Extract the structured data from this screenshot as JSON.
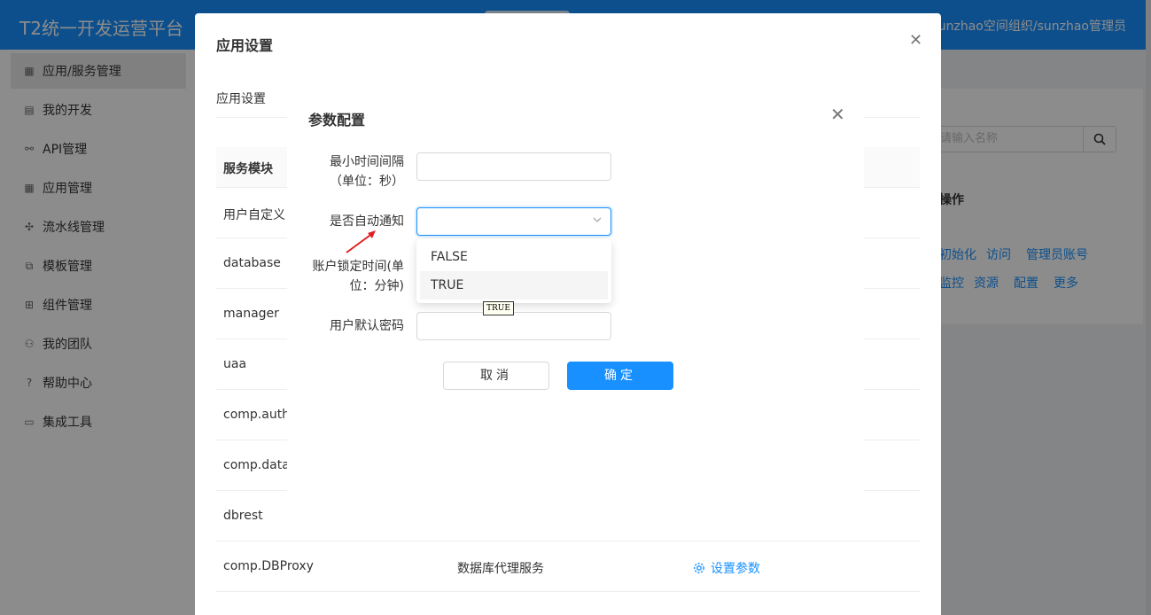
{
  "header": {
    "brand": "T2统一开发运营平台",
    "user": "sunzhao空间组织/sunzhao管理员"
  },
  "sidebar": {
    "items": [
      {
        "label": "应用/服务管理",
        "icon": "grid-icon"
      },
      {
        "label": "我的开发",
        "icon": "book-icon"
      },
      {
        "label": "API管理",
        "icon": "link-icon"
      },
      {
        "label": "应用管理",
        "icon": "apps-icon"
      },
      {
        "label": "流水线管理",
        "icon": "pipeline-icon"
      },
      {
        "label": "模板管理",
        "icon": "template-icon"
      },
      {
        "label": "组件管理",
        "icon": "component-icon"
      },
      {
        "label": "我的团队",
        "icon": "team-icon"
      },
      {
        "label": "帮助中心",
        "icon": "help-icon"
      },
      {
        "label": "集成工具",
        "icon": "folder-icon"
      }
    ]
  },
  "background": {
    "search_placeholder": "请输入名称",
    "ops_header": "操作",
    "links_row1": [
      "初始化",
      "访问",
      "管理员账号"
    ],
    "links_row2": [
      "监控",
      "资源",
      "配置",
      "更多"
    ]
  },
  "app_modal": {
    "title": "应用设置",
    "tab": "应用设置",
    "table_header": "服务模块",
    "rows": [
      {
        "name": "用户自定义",
        "desc": "",
        "action": ""
      },
      {
        "name": "database",
        "desc": "",
        "action": ""
      },
      {
        "name": "manager",
        "desc": "",
        "action": ""
      },
      {
        "name": "uaa",
        "desc": "",
        "action": ""
      },
      {
        "name": "comp.autho",
        "desc": "",
        "action": ""
      },
      {
        "name": "comp.datab",
        "desc": "",
        "action": ""
      },
      {
        "name": "dbrest",
        "desc": "",
        "action": ""
      },
      {
        "name": "comp.DBProxy",
        "desc": "数据库代理服务",
        "action": "设置参数"
      }
    ]
  },
  "param_modal": {
    "title": "参数配置",
    "fields": {
      "min_interval": {
        "label_line1": "最小时间间隔",
        "label_line2": "（单位：秒）",
        "value": ""
      },
      "auto_notify": {
        "label": "是否自动通知",
        "value": ""
      },
      "lock_time": {
        "label_line1": "账户锁定时间(单",
        "label_line2": "位：分钟)",
        "value": ""
      },
      "default_password": {
        "label": "用户默认密码",
        "value": ""
      }
    },
    "dropdown_options": [
      "FALSE",
      "TRUE"
    ],
    "tooltip": "TRUE",
    "cancel_label": "取消",
    "ok_label": "确定"
  }
}
